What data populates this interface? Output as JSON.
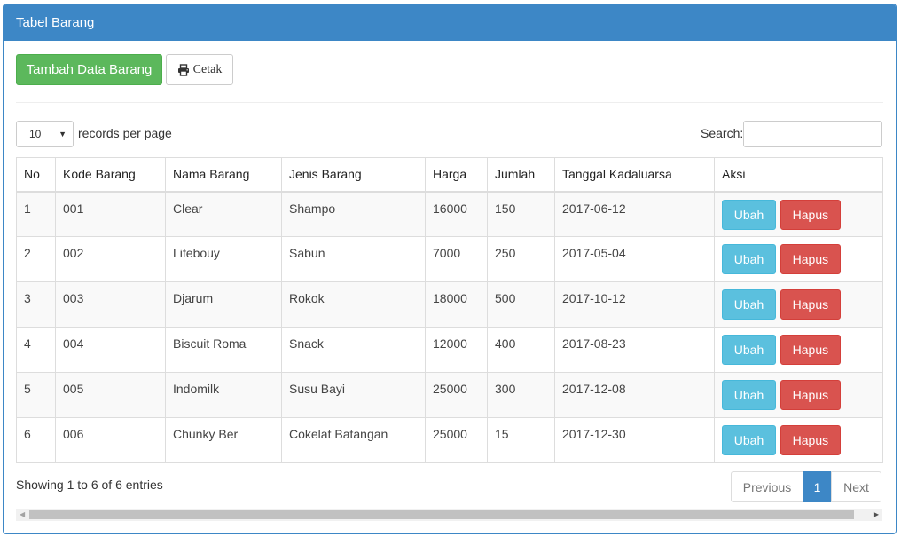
{
  "panel": {
    "title": "Tabel Barang"
  },
  "toolbar": {
    "add_label": "Tambah Data Barang",
    "print_label": "Cetak",
    "print_icon": "print-icon"
  },
  "length": {
    "value": "10",
    "label": "records per page"
  },
  "search": {
    "label": "Search:",
    "value": ""
  },
  "table": {
    "headers": [
      "No",
      "Kode Barang",
      "Nama Barang",
      "Jenis Barang",
      "Harga",
      "Jumlah",
      "Tanggal Kadaluarsa",
      "Aksi"
    ],
    "rows": [
      {
        "no": "1",
        "kode": "001",
        "nama": "Clear",
        "jenis": "Shampo",
        "harga": "16000",
        "jumlah": "150",
        "tanggal": "2017-06-12"
      },
      {
        "no": "2",
        "kode": "002",
        "nama": "Lifebouy",
        "jenis": "Sabun",
        "harga": "7000",
        "jumlah": "250",
        "tanggal": "2017-05-04"
      },
      {
        "no": "3",
        "kode": "003",
        "nama": "Djarum",
        "jenis": "Rokok",
        "harga": "18000",
        "jumlah": "500",
        "tanggal": "2017-10-12"
      },
      {
        "no": "4",
        "kode": "004",
        "nama": "Biscuit Roma",
        "jenis": "Snack",
        "harga": "12000",
        "jumlah": "400",
        "tanggal": "2017-08-23"
      },
      {
        "no": "5",
        "kode": "005",
        "nama": "Indomilk",
        "jenis": "Susu Bayi",
        "harga": "25000",
        "jumlah": "300",
        "tanggal": "2017-12-08"
      },
      {
        "no": "6",
        "kode": "006",
        "nama": "Chunky Ber",
        "jenis": "Cokelat Batangan",
        "harga": "25000",
        "jumlah": "15",
        "tanggal": "2017-12-30"
      }
    ],
    "edit_label": "Ubah",
    "delete_label": "Hapus"
  },
  "info": "Showing 1 to 6 of 6 entries",
  "pagination": {
    "previous": "Previous",
    "current": "1",
    "next": "Next"
  },
  "colors": {
    "primary": "#3d87c6",
    "success": "#5cb85c",
    "info": "#5bc0de",
    "danger": "#d9534f"
  }
}
